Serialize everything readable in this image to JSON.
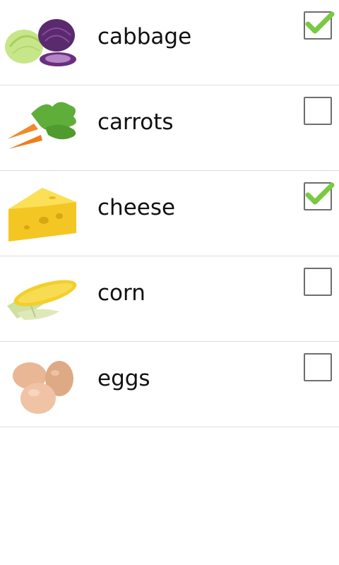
{
  "items": [
    {
      "label": "cabbage",
      "icon": "cabbage-image",
      "checked": true
    },
    {
      "label": "carrots",
      "icon": "carrots-image",
      "checked": false
    },
    {
      "label": "cheese",
      "icon": "cheese-image",
      "checked": true
    },
    {
      "label": "corn",
      "icon": "corn-image",
      "checked": false
    },
    {
      "label": "eggs",
      "icon": "eggs-image",
      "checked": false
    }
  ],
  "colors": {
    "checkmark": "#7ac943",
    "checkbox_border": "#6e6e6e",
    "divider": "#dcdcdc"
  }
}
